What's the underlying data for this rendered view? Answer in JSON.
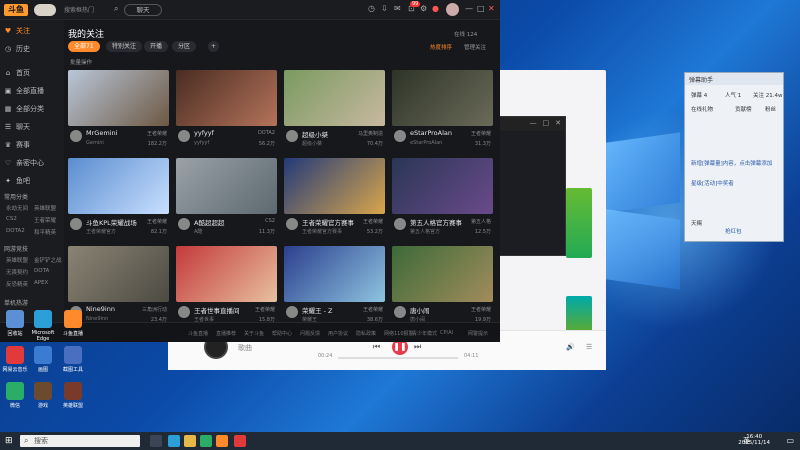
{
  "app": {
    "logo": "斗鱼",
    "search_placeholder": "搜索框热门",
    "tab_chat_label": "聊天",
    "notif_count": "99"
  },
  "sidebar": {
    "items": [
      {
        "icon": "♥",
        "label": "关注"
      },
      {
        "icon": "◷",
        "label": "历史"
      },
      {
        "icon": "⌂",
        "label": "首页"
      },
      {
        "icon": "▣",
        "label": "全部直播"
      },
      {
        "icon": "▦",
        "label": "全部分类"
      },
      {
        "icon": "☰",
        "label": "聊天"
      },
      {
        "icon": "♛",
        "label": "赛事"
      },
      {
        "icon": "♡",
        "label": "亲密中心"
      },
      {
        "icon": "✦",
        "label": "鱼吧"
      }
    ],
    "section1": "常用分类",
    "section1_items": [
      "永劫无间",
      "英雄联盟",
      "CS2",
      "王者荣耀",
      "DOTA2",
      "和平精英"
    ],
    "section2": "网游竞技",
    "section2_items": [
      "英雄联盟",
      "金铲铲之战",
      "无畏契约",
      "DOTA",
      "反恐精英",
      "APEX"
    ],
    "section3": "单机热游"
  },
  "main": {
    "title": "我的关注",
    "tabs": [
      "全部71",
      "特别关注",
      "开播",
      "分区",
      "+"
    ],
    "link_sort": "热度排序",
    "link_manage": "管理关注",
    "online_text": "在线 124",
    "batch": "批量操作",
    "cards": [
      {
        "anchor": "MrGemini",
        "game": "王者荣耀",
        "meta": "Gemini",
        "heat": "182.2万",
        "colors": [
          "#b9c6d8",
          "#6d5843"
        ]
      },
      {
        "anchor": "yyfyyf",
        "game": "DOTA2",
        "meta": "yyfyyf",
        "heat": "56.2万",
        "colors": [
          "#4a2c22",
          "#b4735a"
        ]
      },
      {
        "anchor": "超级小桀",
        "game": "马里奥制造",
        "meta": "超级小桀",
        "heat": "70.4万",
        "colors": [
          "#7a9a60",
          "#c8b8a0"
        ]
      },
      {
        "anchor": "eStarProAlan",
        "game": "王者荣耀",
        "meta": "eStarProAlan",
        "heat": "31.3万",
        "colors": [
          "#2e3428",
          "#6a6a58"
        ]
      },
      {
        "anchor": "斗鱼KPL荣耀战场",
        "game": "王者荣耀",
        "meta": "王者荣耀官方",
        "heat": "82.1万",
        "colors": [
          "#5a8ccf",
          "#c8e0ff"
        ]
      },
      {
        "anchor": "A酷超超超",
        "game": "CS2",
        "meta": "A酷",
        "heat": "11.3万",
        "colors": [
          "#9aa2a8",
          "#5d6870"
        ]
      },
      {
        "anchor": "王者荣耀官方赛事",
        "game": "王者荣耀",
        "meta": "王者荣耀官方赛事",
        "heat": "53.2万",
        "colors": [
          "#223a7a",
          "#d9a64b"
        ]
      },
      {
        "anchor": "第五人格官方赛事",
        "game": "第五人格",
        "meta": "第五人格官方",
        "heat": "12.5万",
        "colors": [
          "#2a3656",
          "#6a4a8a"
        ]
      },
      {
        "anchor": "Nine9inn",
        "game": "三角洲行动",
        "meta": "Nine9inn",
        "heat": "23.4万",
        "colors": [
          "#8a8474",
          "#4c4a42"
        ]
      },
      {
        "anchor": "王者世事直播间",
        "game": "王者荣耀",
        "meta": "王者世事",
        "heat": "15.8万",
        "colors": [
          "#c43a3a",
          "#e8c0a0"
        ]
      },
      {
        "anchor": "荣耀王 - Z",
        "game": "王者荣耀",
        "meta": "荣耀王",
        "heat": "38.6万",
        "colors": [
          "#2b3f8e",
          "#8ec4e0"
        ]
      },
      {
        "anchor": "唐小闹",
        "game": "王者荣耀",
        "meta": "唐小闹",
        "heat": "19.9万",
        "colors": [
          "#3c6a38",
          "#a28c5c"
        ]
      }
    ]
  },
  "footer": {
    "items": [
      "斗鱼直播",
      "直播推荐",
      "关于斗鱼",
      "帮助中心",
      "问题反馈",
      "用户协议",
      "隐私政策",
      "网络110报警",
      "青少年模式",
      "CP/AI",
      "网警提示"
    ]
  },
  "desktop_icons": [
    {
      "label": "回收站",
      "color": "#5b8fd6"
    },
    {
      "label": "Microsoft Edge",
      "color": "#2d9fd8"
    },
    {
      "label": "斗鱼直播",
      "color": "#ff8a2b"
    },
    {
      "label": "网易云音乐",
      "color": "#e23a3a"
    },
    {
      "label": "画图",
      "color": "#3b7bd1"
    },
    {
      "label": "截图工具",
      "color": "#4a6fc0"
    },
    {
      "label": "微信",
      "color": "#2aae67"
    },
    {
      "label": "游戏",
      "color": "#6b4a2e"
    },
    {
      "label": "英雄联盟",
      "color": "#7a3a2a"
    }
  ],
  "chat_panel": {
    "title": "弹幕助手",
    "rows": [
      "弹幕 4",
      "人气 1",
      "关注 21.4w",
      "在线礼物",
      "贡献榜",
      "粉丝",
      "新增[弹幕量]内容，点击弹幕添加",
      "星级[活动]中奖者",
      "天赐",
      "抢红包"
    ]
  },
  "music": {
    "track": "歌曲",
    "time_left": "00:24",
    "time_right": "04:11"
  },
  "taskbar": {
    "search": "搜索",
    "time": "16:40",
    "date": "2025/11/14",
    "ime": "英"
  }
}
